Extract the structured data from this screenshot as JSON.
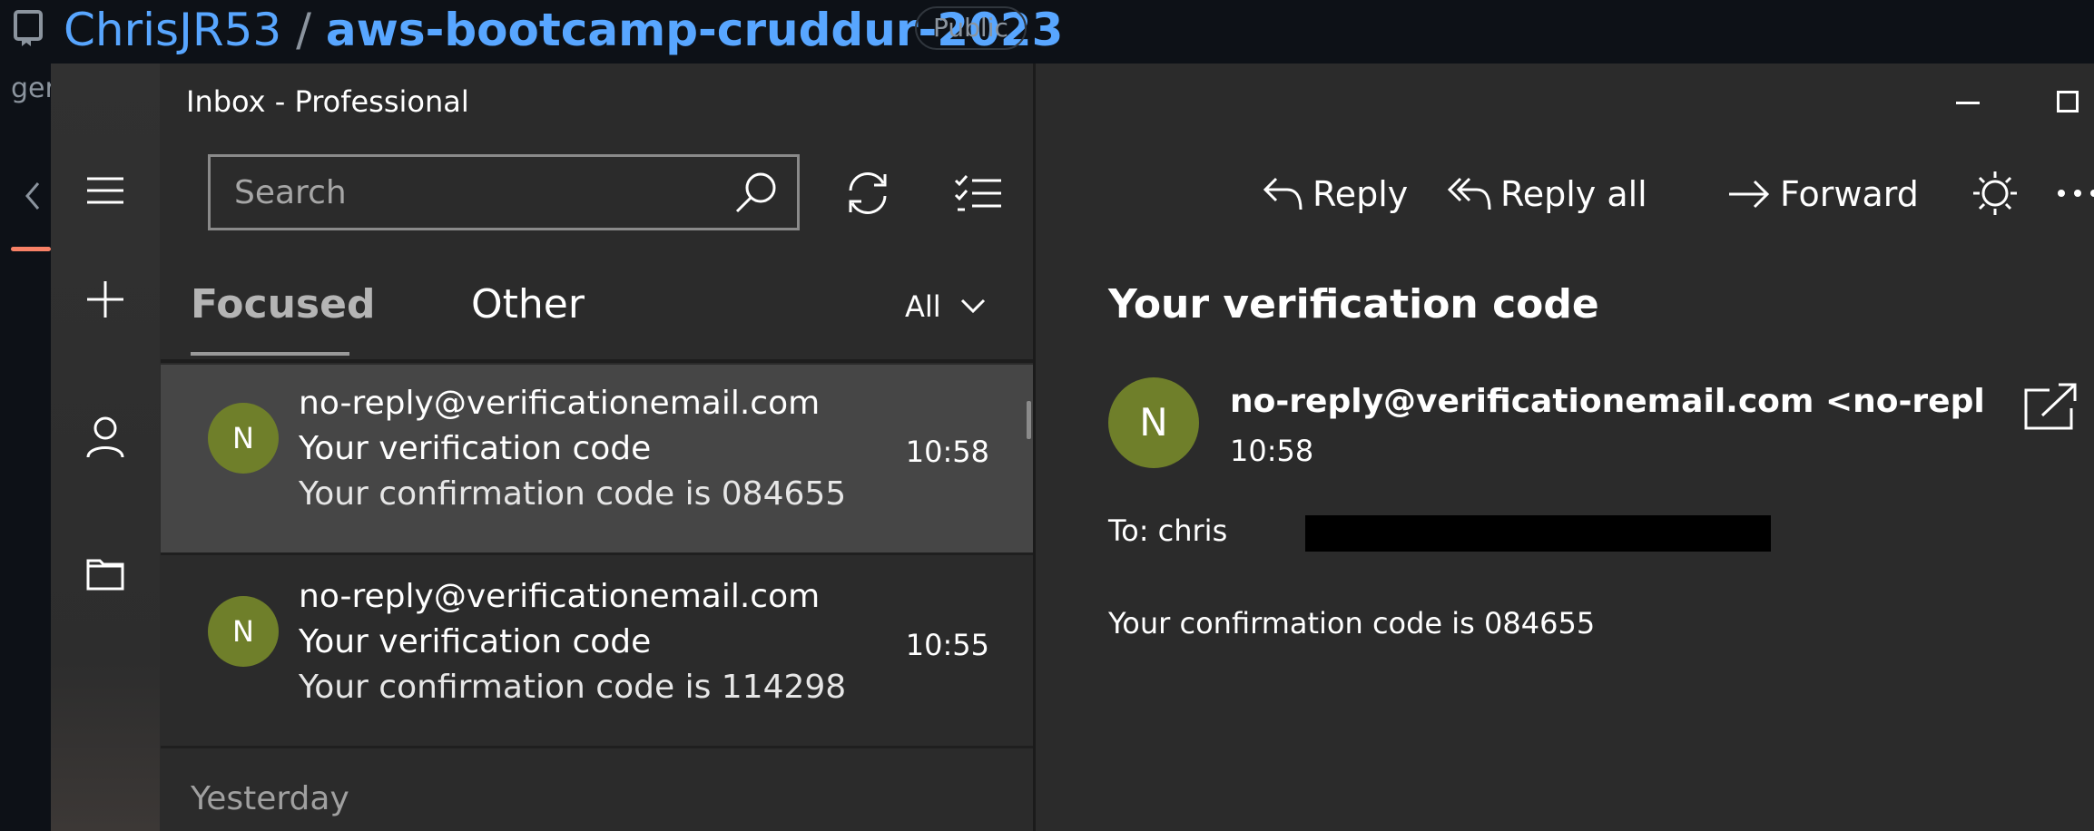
{
  "github": {
    "owner": "ChrisJR53",
    "separator": "/",
    "repo": "aws-bootcamp-cruddur-2023",
    "visibility": "Public",
    "side_text": "ger"
  },
  "mail": {
    "window_title": "Inbox - Professional",
    "search": {
      "placeholder": "Search",
      "value": ""
    },
    "tabs": [
      {
        "label": "Focused",
        "active": true
      },
      {
        "label": "Other",
        "active": false
      }
    ],
    "filter": "All",
    "messages": [
      {
        "avatar": "N",
        "from": "no-reply@verificationemail.com",
        "subject": "Your verification code",
        "preview": "Your confirmation code is 084655",
        "time": "10:58",
        "selected": true
      },
      {
        "avatar": "N",
        "from": "no-reply@verificationemail.com",
        "subject": "Your verification code",
        "preview": "Your confirmation code is 114298",
        "time": "10:55",
        "selected": false
      }
    ],
    "group_header": "Yesterday",
    "reading": {
      "toolbar": {
        "reply": "Reply",
        "reply_all": "Reply all",
        "forward": "Forward"
      },
      "subject": "Your verification code",
      "avatar": "N",
      "sender": "no-reply@verificationemail.com <no-reply@verif",
      "time": "10:58",
      "to": "To: chris",
      "body": "Your confirmation code is 084655"
    }
  },
  "colors": {
    "accent_link": "#58a6ff",
    "avatar": "#6f7f2a",
    "selected_row": "#464646",
    "pane_bg": "#2b2b2b"
  },
  "icons": [
    "repo-icon",
    "chevron-left-icon",
    "hamburger-menu-icon",
    "plus-icon",
    "person-icon",
    "folder-icon",
    "search-icon",
    "sync-icon",
    "select-list-icon",
    "chevron-down-icon",
    "minimize-icon",
    "maximize-icon",
    "reply-icon",
    "reply-all-icon",
    "forward-arrow-icon",
    "brightness-icon",
    "more-icon",
    "popout-icon"
  ]
}
